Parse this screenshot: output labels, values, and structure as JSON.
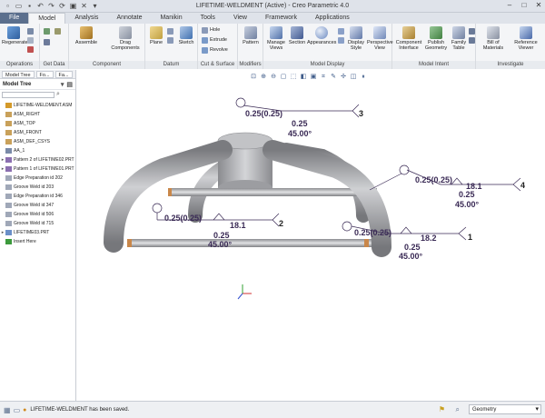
{
  "window": {
    "title": "LIFETIME-WELDMENT (Active) - Creo Parametric 4.0"
  },
  "tabs": [
    {
      "label": "File"
    },
    {
      "label": "Model"
    },
    {
      "label": "Analysis"
    },
    {
      "label": "Annotate"
    },
    {
      "label": "Manikin"
    },
    {
      "label": "Tools"
    },
    {
      "label": "View"
    },
    {
      "label": "Framework"
    },
    {
      "label": "Applications"
    }
  ],
  "ribbon": {
    "groups": {
      "operations": "Operations",
      "get_data": "Get Data",
      "component": "Component",
      "datum": "Datum",
      "cut_surface": "Cut & Surface",
      "modifiers": "Modifiers",
      "model_display": "Model Display",
      "model_intent": "Model Intent",
      "investigate": "Investigate"
    },
    "buttons": {
      "regenerate": "Regenerate",
      "assemble": "Assemble",
      "drag_components": "Drag Components",
      "plane": "Plane",
      "sketch": "Sketch",
      "hole": "Hole",
      "extrude": "Extrude",
      "revolve": "Revolve",
      "pattern": "Pattern",
      "manage_views": "Manage Views",
      "section": "Section",
      "appearances": "Appearances",
      "display_style": "Display Style",
      "perspective_view": "Perspective View",
      "component_interface": "Component Interface",
      "publish_geometry": "Publish Geometry",
      "family_table": "Family Table",
      "bill_of_materials": "Bill of Materials",
      "reference_viewer": "Reference Viewer"
    }
  },
  "panel": {
    "tabs": [
      "Model Tree",
      "Fo...",
      "Fa..."
    ],
    "tree_title": "Model Tree",
    "items": [
      {
        "label": "LIFETIME-WELDMENT.ASM",
        "expander": "",
        "color": "#d49a2a"
      },
      {
        "label": "ASM_RIGHT",
        "expander": "",
        "color": "#c9a15a"
      },
      {
        "label": "ASM_TOP",
        "expander": "",
        "color": "#c9a15a"
      },
      {
        "label": "ASM_FRONT",
        "expander": "",
        "color": "#c9a15a"
      },
      {
        "label": "ASM_DEF_CSYS",
        "expander": "",
        "color": "#c9a15a"
      },
      {
        "label": "AA_1",
        "expander": "",
        "color": "#7a8aa8"
      },
      {
        "label": "Pattern 2 of LIFETIME02.PRT",
        "expander": "▸",
        "color": "#8b6fb0"
      },
      {
        "label": "Pattern 1 of LIFETIME01.PRT",
        "expander": "▸",
        "color": "#8b6fb0"
      },
      {
        "label": "Edge Preparation id 202",
        "expander": "",
        "color": "#a0a8b8"
      },
      {
        "label": "Groove Weld id 203",
        "expander": "",
        "color": "#a0a8b8"
      },
      {
        "label": "Edge Preparation id 346",
        "expander": "",
        "color": "#a0a8b8"
      },
      {
        "label": "Groove Weld id 347",
        "expander": "",
        "color": "#a0a8b8"
      },
      {
        "label": "Groove Weld id 506",
        "expander": "",
        "color": "#a0a8b8"
      },
      {
        "label": "Groove Weld id 715",
        "expander": "",
        "color": "#a0a8b8"
      },
      {
        "label": "LIFETIME03.PRT",
        "expander": "▸",
        "color": "#6a8fc8"
      },
      {
        "label": "Insert Here",
        "expander": "",
        "color": "#3c9a3c"
      }
    ]
  },
  "welds": [
    {
      "id": "3",
      "top": "0.25(0.25)",
      "mid": "0.25",
      "angle": "45.00°",
      "len": ""
    },
    {
      "id": "4",
      "top": "0.25(0.25)",
      "mid": "0.25",
      "angle": "45.00°",
      "len": "18.1"
    },
    {
      "id": "2",
      "top": "0.25(0.25)",
      "mid": "0.25",
      "angle": "45.00°",
      "len": "18.1"
    },
    {
      "id": "1",
      "top": "0.25(0.25)",
      "mid": "0.25",
      "angle": "45.00°",
      "len": "18.2"
    }
  ],
  "status": {
    "message": "LIFETIME-WELDMENT has been saved.",
    "filter": "Geometry"
  },
  "colors": {
    "weld_annotation": "#3a2a55",
    "tube": "#9a9b9f",
    "weld_bead": "#c9874a",
    "accent": "#5b6f8d"
  }
}
